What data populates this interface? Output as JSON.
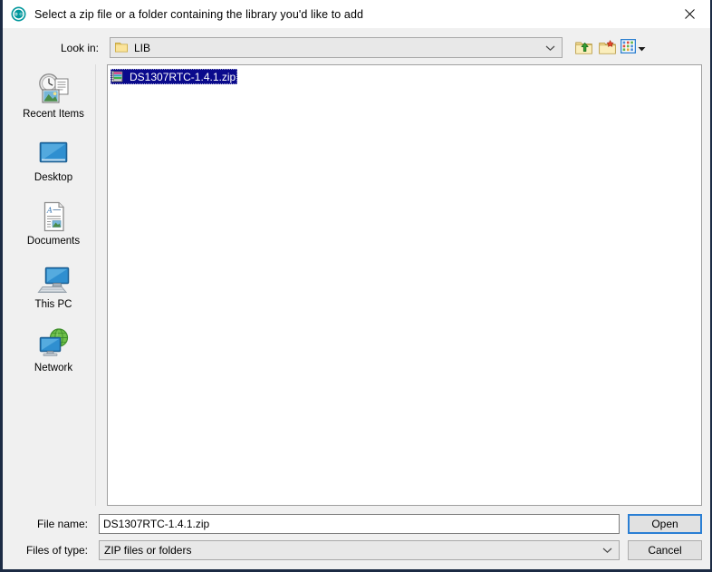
{
  "window": {
    "title": "Select a zip file or a folder containing the library you'd like to add",
    "app_icon": "arduino-logo-icon",
    "close_icon": "close-icon",
    "accent_color": "#2a7fd4",
    "titlebar_bg": "#ffffff",
    "body_bg": "#f0f0f0",
    "border_color": "#1c2b44"
  },
  "lookin": {
    "label": "Look in:",
    "value": "LIB",
    "folder_icon": "folder-icon",
    "arrow_icon": "chevron-down-icon"
  },
  "toolbar": {
    "up_one_level": {
      "name": "up-one-level-button",
      "icon": "folder-up-arrow-icon",
      "tooltip": "Up One Level"
    },
    "new_folder": {
      "name": "create-new-folder-button",
      "icon": "folder-new-star-icon",
      "tooltip": "Create New Folder"
    },
    "view_menu": {
      "name": "view-menu-button",
      "icon": "view-grid-icon",
      "arrow_icon": "dropdown-triangle-icon",
      "tooltip": "View Menu"
    }
  },
  "places": [
    {
      "label": "Recent Items",
      "icon": "recent-items-icon",
      "name": "sidebar-item-recent-items"
    },
    {
      "label": "Desktop",
      "icon": "desktop-icon",
      "name": "sidebar-item-desktop"
    },
    {
      "label": "Documents",
      "icon": "documents-icon",
      "name": "sidebar-item-documents"
    },
    {
      "label": "This PC",
      "icon": "this-pc-icon",
      "name": "sidebar-item-this-pc"
    },
    {
      "label": "Network",
      "icon": "network-icon",
      "name": "sidebar-item-network"
    }
  ],
  "files": [
    {
      "name": "DS1307RTC-1.4.1.zip",
      "icon": "zip-archive-icon",
      "selected": true
    }
  ],
  "selection_color": "#0a0a8c",
  "form": {
    "filename_label": "File name:",
    "filename_value": "DS1307RTC-1.4.1.zip",
    "filename_placeholder": "",
    "filetype_label": "Files of type:",
    "filetype_value": "ZIP files or folders",
    "filetype_arrow_icon": "chevron-down-icon"
  },
  "buttons": {
    "open": "Open",
    "cancel": "Cancel"
  }
}
